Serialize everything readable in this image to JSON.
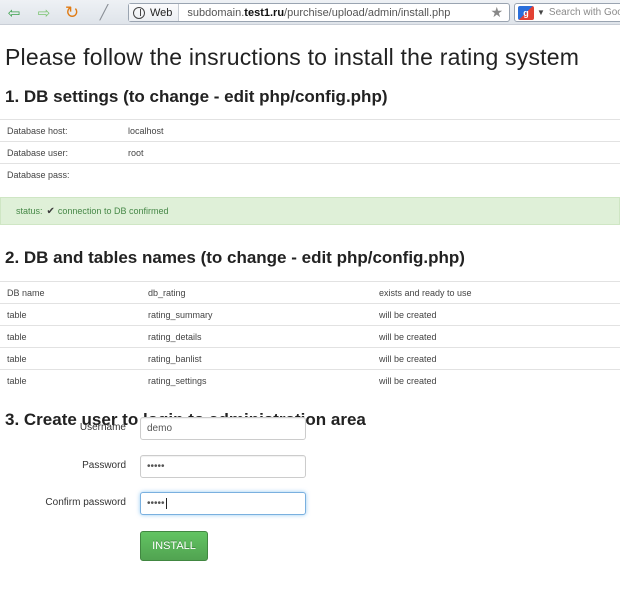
{
  "browser": {
    "web_chip": "Web",
    "url_prefix": "subdomain.",
    "url_domain": "test1.ru",
    "url_path": "/purchise/upload/admin/install.php",
    "search_placeholder": "Search with Goo",
    "icons": [
      "back-arrow-icon",
      "forward-arrow-icon",
      "reload-icon",
      "wrench-icon",
      "globe-icon",
      "star-icon",
      "google-icon"
    ]
  },
  "page": {
    "title": "Please follow the insructions to install the rating system"
  },
  "db_settings": {
    "heading": "1. DB settings (to change - edit php/config.php)",
    "rows": [
      {
        "label": "Database host:",
        "value": "localhost"
      },
      {
        "label": "Database user:",
        "value": "root"
      },
      {
        "label": "Database pass:",
        "value": ""
      }
    ],
    "status_prefix": "status:",
    "status_text": "connection to DB confirmed"
  },
  "tables": {
    "heading": "2. DB and tables names (to change - edit php/config.php)",
    "rows": [
      {
        "type": "DB name",
        "name": "db_rating",
        "state": "exists and ready to use"
      },
      {
        "type": "table",
        "name": "rating_summary",
        "state": "will be created"
      },
      {
        "type": "table",
        "name": "rating_details",
        "state": "will be created"
      },
      {
        "type": "table",
        "name": "rating_banlist",
        "state": "will be created"
      },
      {
        "type": "table",
        "name": "rating_settings",
        "state": "will be created"
      }
    ]
  },
  "user_form": {
    "heading": "3. Create user to login to administration area",
    "username_label": "Username",
    "username_value": "demo",
    "password_label": "Password",
    "password_value": "•••••",
    "confirm_label": "Confirm password",
    "confirm_value": "•••••",
    "submit_label": "INSTALL"
  },
  "colors": {
    "status_bg": "#dff0d8",
    "status_text": "#468847",
    "button_green": "#51a351",
    "focus_border": "#7ab0df"
  }
}
